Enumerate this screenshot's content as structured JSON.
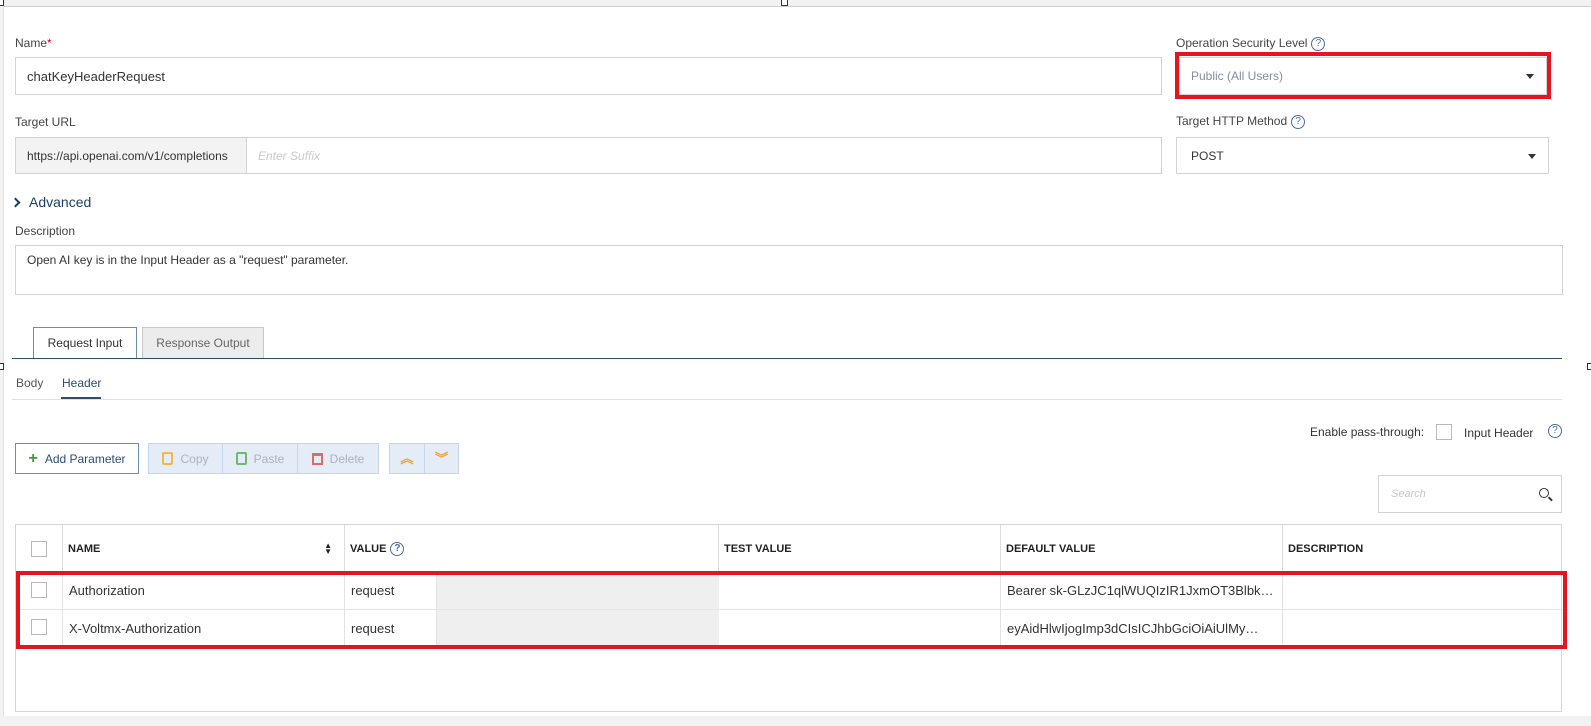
{
  "form": {
    "name_label": "Name",
    "name_required": "*",
    "name_value": "chatKeyHeaderRequest",
    "security_label": "Operation Security Level",
    "security_value": "Public (All Users)",
    "target_url_label": "Target URL",
    "target_url_prefix": "https://api.openai.com/v1/completions",
    "target_url_placeholder": "Enter Suffix",
    "http_method_label": "Target HTTP Method",
    "http_method_value": "POST",
    "advanced_label": "Advanced",
    "description_label": "Description",
    "description_value": "Open AI key is in the Input Header as a \"request\" parameter.",
    "help_glyph": "?"
  },
  "tabs": [
    {
      "label": "Request Input",
      "active": true
    },
    {
      "label": "Response Output",
      "active": false
    }
  ],
  "subtabs": [
    {
      "label": "Body",
      "active": false
    },
    {
      "label": "Header",
      "active": true
    }
  ],
  "toolbar": {
    "add_label": "Add Parameter",
    "copy_label": "Copy",
    "paste_label": "Paste",
    "delete_label": "Delete",
    "move_up_glyph": "︽",
    "move_down_glyph": "︾",
    "pass_through_label": "Enable pass-through:",
    "input_header_label": "Input Header",
    "search_placeholder": "Search"
  },
  "table": {
    "headers": [
      "NAME",
      "VALUE",
      "TEST VALUE",
      "DEFAULT VALUE",
      "DESCRIPTION"
    ],
    "rows": [
      {
        "name": "Authorization",
        "value": "request",
        "test_value": "",
        "default_value": "Bearer sk-GLzJC1qlWUQIzIR1JxmOT3Blbk…",
        "description": ""
      },
      {
        "name": "X-Voltmx-Authorization",
        "value": "request",
        "test_value": "",
        "default_value": "eyAidHlwIjogImp3dCIsICJhbGciOiAiUlMy…",
        "description": ""
      }
    ]
  },
  "colors": {
    "highlight": "#e3151f",
    "accent": "#2b4d77"
  }
}
